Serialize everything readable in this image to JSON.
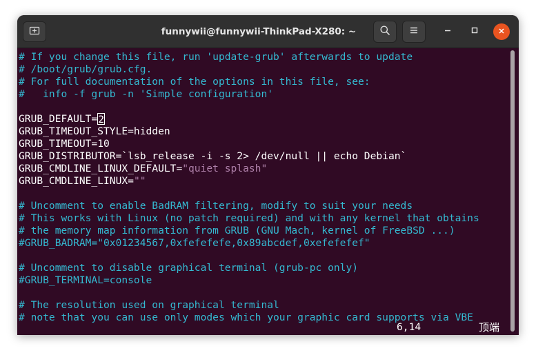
{
  "window": {
    "title": "funnywii@funnywii-ThinkPad-X280: ~"
  },
  "header": {
    "new_tab_icon": "new-tab-icon",
    "search_icon": "search-icon",
    "menu_icon": "hamburger-menu-icon",
    "minimize_icon": "minimize-icon",
    "maximize_icon": "maximize-icon",
    "close_icon": "close-icon"
  },
  "colors": {
    "background": "#300a24",
    "comment": "#34b9d1",
    "string": "#ad7fa8",
    "text": "#ffffff",
    "close_button": "#e95420",
    "titlebar": "#303030"
  },
  "editor": {
    "lines": [
      {
        "segments": [
          {
            "text": "# If you change this file, run 'update-grub' afterwards to update",
            "type": "comment"
          }
        ]
      },
      {
        "segments": [
          {
            "text": "# /boot/grub/grub.cfg.",
            "type": "comment"
          }
        ]
      },
      {
        "segments": [
          {
            "text": "# For full documentation of the options in this file, see:",
            "type": "comment"
          }
        ]
      },
      {
        "segments": [
          {
            "text": "#   info -f grub -n 'Simple configuration'",
            "type": "comment"
          }
        ]
      },
      {
        "segments": [
          {
            "text": "",
            "type": "text"
          }
        ]
      },
      {
        "segments": [
          {
            "text": "GRUB_DEFAULT=",
            "type": "text"
          },
          {
            "text": "2",
            "type": "cursor"
          }
        ]
      },
      {
        "segments": [
          {
            "text": "GRUB_TIMEOUT_STYLE=hidden",
            "type": "text"
          }
        ]
      },
      {
        "segments": [
          {
            "text": "GRUB_TIMEOUT=10",
            "type": "text"
          }
        ]
      },
      {
        "segments": [
          {
            "text": "GRUB_DISTRIBUTOR=`lsb_release -i -s 2> /dev/null || echo Debian`",
            "type": "text"
          }
        ]
      },
      {
        "segments": [
          {
            "text": "GRUB_CMDLINE_LINUX_DEFAULT=",
            "type": "text"
          },
          {
            "text": "\"quiet splash\"",
            "type": "string"
          }
        ]
      },
      {
        "segments": [
          {
            "text": "GRUB_CMDLINE_LINUX=",
            "type": "text"
          },
          {
            "text": "\"\"",
            "type": "string"
          }
        ]
      },
      {
        "segments": [
          {
            "text": "",
            "type": "text"
          }
        ]
      },
      {
        "segments": [
          {
            "text": "# Uncomment to enable BadRAM filtering, modify to suit your needs",
            "type": "comment"
          }
        ]
      },
      {
        "segments": [
          {
            "text": "# This works with Linux (no patch required) and with any kernel that obtains",
            "type": "comment"
          }
        ]
      },
      {
        "segments": [
          {
            "text": "# the memory map information from GRUB (GNU Mach, kernel of FreeBSD ...)",
            "type": "comment"
          }
        ]
      },
      {
        "segments": [
          {
            "text": "#GRUB_BADRAM=\"0x01234567,0xfefefefe,0x89abcdef,0xefefefef\"",
            "type": "comment"
          }
        ]
      },
      {
        "segments": [
          {
            "text": "",
            "type": "text"
          }
        ]
      },
      {
        "segments": [
          {
            "text": "# Uncomment to disable graphical terminal (grub-pc only)",
            "type": "comment"
          }
        ]
      },
      {
        "segments": [
          {
            "text": "#GRUB_TERMINAL=console",
            "type": "comment"
          }
        ]
      },
      {
        "segments": [
          {
            "text": "",
            "type": "text"
          }
        ]
      },
      {
        "segments": [
          {
            "text": "# The resolution used on graphical terminal",
            "type": "comment"
          }
        ]
      },
      {
        "segments": [
          {
            "text": "# note that you can use only modes which your graphic card supports via VBE",
            "type": "comment"
          }
        ]
      }
    ]
  },
  "statusline": {
    "position": "6,14",
    "scroll": "顶端"
  }
}
